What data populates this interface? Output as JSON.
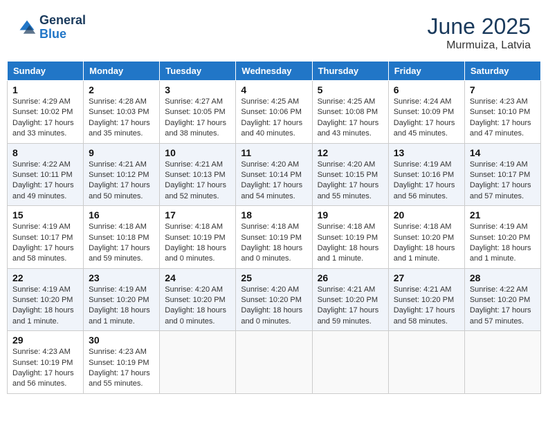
{
  "header": {
    "logo_general": "General",
    "logo_blue": "Blue",
    "month": "June 2025",
    "location": "Murmuiza, Latvia"
  },
  "days_of_week": [
    "Sunday",
    "Monday",
    "Tuesday",
    "Wednesday",
    "Thursday",
    "Friday",
    "Saturday"
  ],
  "weeks": [
    [
      {
        "day": "1",
        "info": "Sunrise: 4:29 AM\nSunset: 10:02 PM\nDaylight: 17 hours\nand 33 minutes."
      },
      {
        "day": "2",
        "info": "Sunrise: 4:28 AM\nSunset: 10:03 PM\nDaylight: 17 hours\nand 35 minutes."
      },
      {
        "day": "3",
        "info": "Sunrise: 4:27 AM\nSunset: 10:05 PM\nDaylight: 17 hours\nand 38 minutes."
      },
      {
        "day": "4",
        "info": "Sunrise: 4:25 AM\nSunset: 10:06 PM\nDaylight: 17 hours\nand 40 minutes."
      },
      {
        "day": "5",
        "info": "Sunrise: 4:25 AM\nSunset: 10:08 PM\nDaylight: 17 hours\nand 43 minutes."
      },
      {
        "day": "6",
        "info": "Sunrise: 4:24 AM\nSunset: 10:09 PM\nDaylight: 17 hours\nand 45 minutes."
      },
      {
        "day": "7",
        "info": "Sunrise: 4:23 AM\nSunset: 10:10 PM\nDaylight: 17 hours\nand 47 minutes."
      }
    ],
    [
      {
        "day": "8",
        "info": "Sunrise: 4:22 AM\nSunset: 10:11 PM\nDaylight: 17 hours\nand 49 minutes."
      },
      {
        "day": "9",
        "info": "Sunrise: 4:21 AM\nSunset: 10:12 PM\nDaylight: 17 hours\nand 50 minutes."
      },
      {
        "day": "10",
        "info": "Sunrise: 4:21 AM\nSunset: 10:13 PM\nDaylight: 17 hours\nand 52 minutes."
      },
      {
        "day": "11",
        "info": "Sunrise: 4:20 AM\nSunset: 10:14 PM\nDaylight: 17 hours\nand 54 minutes."
      },
      {
        "day": "12",
        "info": "Sunrise: 4:20 AM\nSunset: 10:15 PM\nDaylight: 17 hours\nand 55 minutes."
      },
      {
        "day": "13",
        "info": "Sunrise: 4:19 AM\nSunset: 10:16 PM\nDaylight: 17 hours\nand 56 minutes."
      },
      {
        "day": "14",
        "info": "Sunrise: 4:19 AM\nSunset: 10:17 PM\nDaylight: 17 hours\nand 57 minutes."
      }
    ],
    [
      {
        "day": "15",
        "info": "Sunrise: 4:19 AM\nSunset: 10:17 PM\nDaylight: 17 hours\nand 58 minutes."
      },
      {
        "day": "16",
        "info": "Sunrise: 4:18 AM\nSunset: 10:18 PM\nDaylight: 17 hours\nand 59 minutes."
      },
      {
        "day": "17",
        "info": "Sunrise: 4:18 AM\nSunset: 10:19 PM\nDaylight: 18 hours\nand 0 minutes."
      },
      {
        "day": "18",
        "info": "Sunrise: 4:18 AM\nSunset: 10:19 PM\nDaylight: 18 hours\nand 0 minutes."
      },
      {
        "day": "19",
        "info": "Sunrise: 4:18 AM\nSunset: 10:19 PM\nDaylight: 18 hours\nand 1 minute."
      },
      {
        "day": "20",
        "info": "Sunrise: 4:18 AM\nSunset: 10:20 PM\nDaylight: 18 hours\nand 1 minute."
      },
      {
        "day": "21",
        "info": "Sunrise: 4:19 AM\nSunset: 10:20 PM\nDaylight: 18 hours\nand 1 minute."
      }
    ],
    [
      {
        "day": "22",
        "info": "Sunrise: 4:19 AM\nSunset: 10:20 PM\nDaylight: 18 hours\nand 1 minute."
      },
      {
        "day": "23",
        "info": "Sunrise: 4:19 AM\nSunset: 10:20 PM\nDaylight: 18 hours\nand 1 minute."
      },
      {
        "day": "24",
        "info": "Sunrise: 4:20 AM\nSunset: 10:20 PM\nDaylight: 18 hours\nand 0 minutes."
      },
      {
        "day": "25",
        "info": "Sunrise: 4:20 AM\nSunset: 10:20 PM\nDaylight: 18 hours\nand 0 minutes."
      },
      {
        "day": "26",
        "info": "Sunrise: 4:21 AM\nSunset: 10:20 PM\nDaylight: 17 hours\nand 59 minutes."
      },
      {
        "day": "27",
        "info": "Sunrise: 4:21 AM\nSunset: 10:20 PM\nDaylight: 17 hours\nand 58 minutes."
      },
      {
        "day": "28",
        "info": "Sunrise: 4:22 AM\nSunset: 10:20 PM\nDaylight: 17 hours\nand 57 minutes."
      }
    ],
    [
      {
        "day": "29",
        "info": "Sunrise: 4:23 AM\nSunset: 10:19 PM\nDaylight: 17 hours\nand 56 minutes."
      },
      {
        "day": "30",
        "info": "Sunrise: 4:23 AM\nSunset: 10:19 PM\nDaylight: 17 hours\nand 55 minutes."
      },
      {
        "day": "",
        "info": ""
      },
      {
        "day": "",
        "info": ""
      },
      {
        "day": "",
        "info": ""
      },
      {
        "day": "",
        "info": ""
      },
      {
        "day": "",
        "info": ""
      }
    ]
  ]
}
